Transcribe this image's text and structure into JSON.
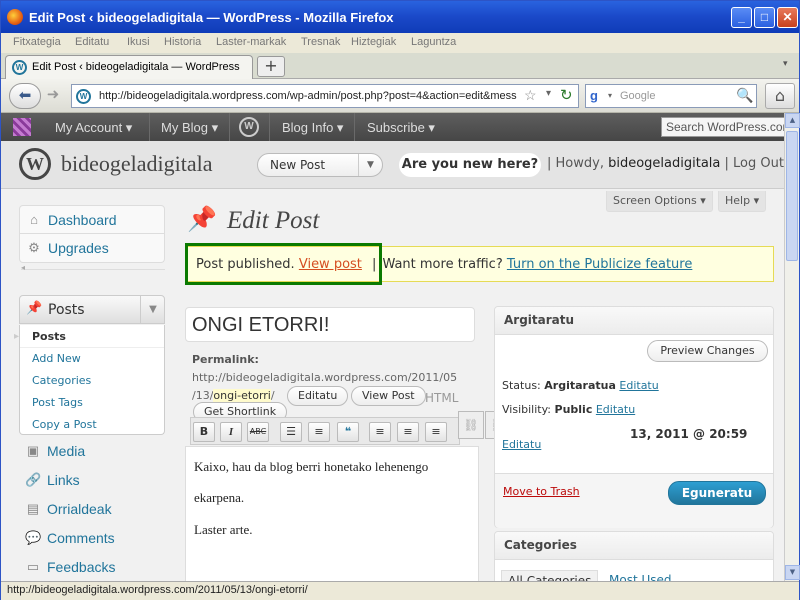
{
  "window": {
    "title": "Edit Post ‹ bideogeladigitala — WordPress - Mozilla Firefox"
  },
  "menubar": {
    "items": [
      "Fitxategia",
      "Editatu",
      "Ikusi",
      "Historia",
      "Laster-markak",
      "Tresnak",
      "Hiztegiak",
      "Laguntza"
    ]
  },
  "tab": {
    "title": "Edit Post ‹ bideogeladigitala — WordPress",
    "new_tab": "+"
  },
  "nav": {
    "url": "http://bideogeladigitala.wordpress.com/wp-admin/post.php?post=4&action=edit&mess",
    "search_placeholder": "Google"
  },
  "statusbar": {
    "text": "http://bideogeladigitala.wordpress.com/2011/05/13/ongi-etorri/"
  },
  "adminbar": {
    "my_account": "My Account ▾",
    "my_blog": "My Blog ▾",
    "blog_info": "Blog Info ▾",
    "subscribe": "Subscribe ▾",
    "search": "Search WordPress.com"
  },
  "header": {
    "site": "bideogeladigitala",
    "new_post": "New Post",
    "new_here": "Are you new here?",
    "howdy_prefix": "| Howdy,",
    "user": "bideogeladigitala",
    "logout": "| Log Out"
  },
  "screen": {
    "options": "Screen Options ▾",
    "help": "Help ▾"
  },
  "sidebar": {
    "dashboard": "Dashboard",
    "upgrades": "Upgrades",
    "posts": "Posts",
    "posts_sub": [
      "Posts",
      "Add New",
      "Categories",
      "Post Tags",
      "Copy a Post"
    ],
    "media": "Media",
    "links": "Links",
    "pages": "Orrialdeak",
    "comments": "Comments",
    "feedbacks": "Feedbacks"
  },
  "main": {
    "heading": "Edit Post",
    "notice": {
      "published": "Post published.",
      "view_post": "View post",
      "sep": "|",
      "traffic": "Want more traffic?",
      "publicize": "Turn on the Publicize feature"
    },
    "post_title": "ONGI ETORRI!",
    "permalink": {
      "label": "Permalink:",
      "url_line1": "http://bideogeladigitala.wordpress.com/2011/05",
      "url_line2_prefix": "/13/",
      "slug": "ongi-etorri",
      "url_line2_suffix": "/",
      "edit": "Editatu",
      "view": "View Post",
      "shortlink": "Get Shortlink",
      "html_tab": "HTML"
    },
    "toolbar": {
      "bold": "B",
      "italic": "I",
      "strike": "ABC"
    },
    "content": [
      "Kaixo, hau da blog berri honetako lehenengo",
      "ekarpena.",
      "Laster arte."
    ]
  },
  "publish": {
    "title": "Argitaratu",
    "preview": "Preview Changes",
    "status_label": "Status:",
    "status_value": "Argitaratua",
    "status_edit": "Editatu",
    "visibility_label": "Visibility:",
    "visibility_value": "Public",
    "visibility_edit": "Editatu",
    "date_value": "13, 2011 @ 20:59",
    "date_edit": "Editatu",
    "trash": "Move to Trash",
    "update": "Eguneratu"
  },
  "categories": {
    "title": "Categories",
    "all": "All Categories",
    "most_used": "Most Used"
  }
}
